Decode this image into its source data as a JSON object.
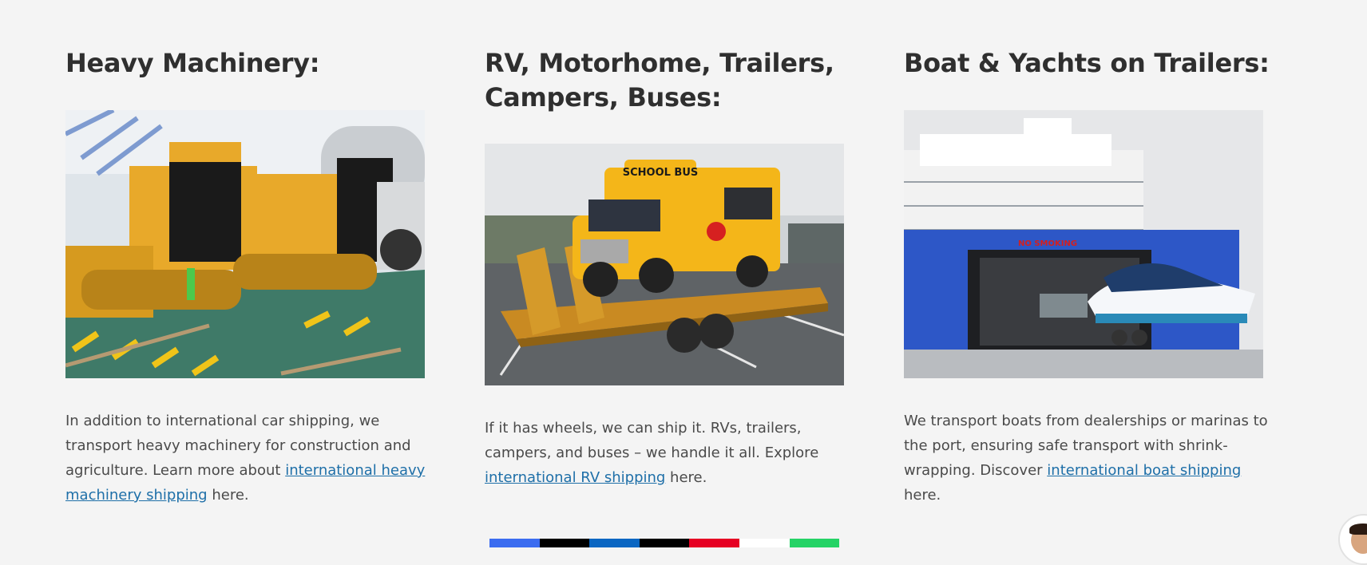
{
  "sections": [
    {
      "heading": "Heavy Machinery:",
      "image_alt": "Yellow crawler bulldozers chained on a ship deck",
      "desc_before": "In addition to international car shipping, we transport heavy machinery for construction and agriculture. Learn more about ",
      "link_text": "international heavy machinery shipping",
      "desc_after": " here."
    },
    {
      "heading": "RV, Motorhome, Trailers, Campers, Buses:",
      "image_alt": "Yellow school bus loaded on a flatbed trailer",
      "image_sign_text": "SCHOOL BUS",
      "desc_before": "If it has wheels, we can ship it. RVs, trailers, campers, and buses – we handle it all. Explore ",
      "link_text": "international RV shipping",
      "desc_after": " here."
    },
    {
      "heading": "Boat & Yachts on Trailers:",
      "image_alt": "Boat on trailer being loaded into a RoRo ship",
      "image_sign_text": "NO SMOKING",
      "desc_before": "We transport boats from dealerships or marinas to the port, ensuring safe transport with shrink-wrapping. Discover ",
      "link_text": "international boat shipping",
      "desc_after": " here."
    }
  ],
  "share_buttons": [
    {
      "name": "facebook",
      "color": "#3b6cf0"
    },
    {
      "name": "x",
      "color": "#000000"
    },
    {
      "name": "linkedin",
      "color": "#0a66c2"
    },
    {
      "name": "tiktok",
      "color": "#000000"
    },
    {
      "name": "pinterest",
      "color": "#e60023"
    },
    {
      "name": "email",
      "color": "#ffffff"
    },
    {
      "name": "whatsapp",
      "color": "#25d366"
    }
  ],
  "colors": {
    "link": "#1e6fa8",
    "background": "#f4f4f4",
    "heading": "#2f2f2f"
  }
}
